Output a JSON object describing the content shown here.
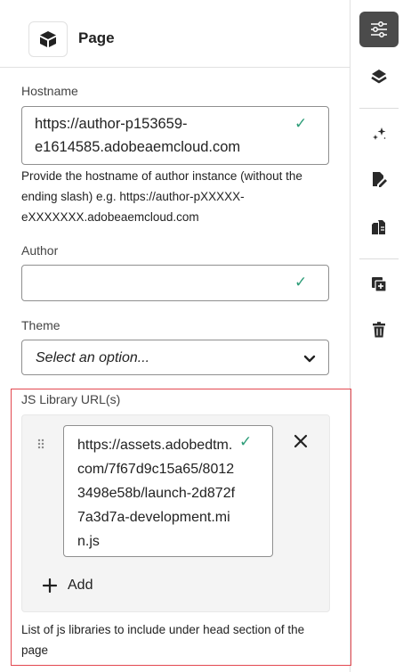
{
  "panel": {
    "title": "Page",
    "hostname": {
      "label": "Hostname",
      "value": "https://author-p153659-\ne1614585.adobeaemcloud.com",
      "help": "Provide the hostname of author instance (without the ending slash) e.g. https://author-pXXXXX-eXXXXXXX.adobeaemcloud.com"
    },
    "author": {
      "label": "Author",
      "value": ""
    },
    "theme": {
      "label": "Theme",
      "placeholder": "Select an option..."
    },
    "js_library": {
      "label": "JS Library URL(s)",
      "items": [
        {
          "value": "https://assets.adobedtm.com/7f67d9c15a65/80123498e58b/launch-2d872f7a3d7a-development.min.js"
        }
      ],
      "add_label": "Add",
      "help": "List of js libraries to include under head section of the page"
    }
  },
  "colors": {
    "valid": "#2d9d78",
    "highlight_border": "#e34850",
    "rail_active": "#4b4b4b"
  },
  "rail": {
    "items": [
      {
        "icon": "properties-icon",
        "active": true
      },
      {
        "icon": "layers-icon",
        "active": false
      },
      {
        "icon": "magic-wand-icon",
        "active": false
      },
      {
        "icon": "edit-document-icon",
        "active": false
      },
      {
        "icon": "files-icon",
        "active": false
      },
      {
        "icon": "add-copy-icon",
        "active": false
      },
      {
        "icon": "delete-icon",
        "active": false
      }
    ]
  }
}
